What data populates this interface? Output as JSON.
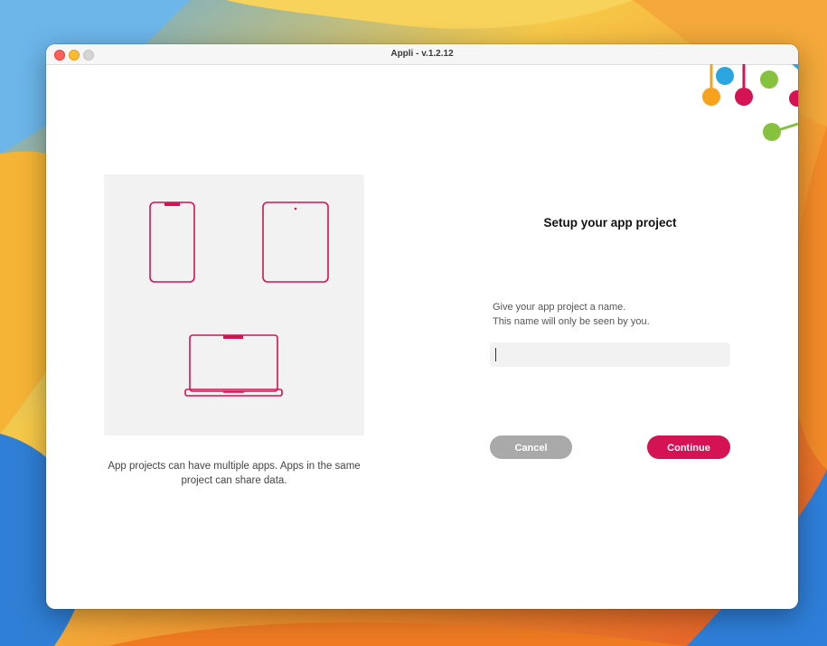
{
  "window": {
    "title": "Appli - v.1.2.12"
  },
  "illustration": {
    "icons": [
      "phone-icon",
      "tablet-icon",
      "laptop-icon"
    ],
    "caption": "App projects can have multiple apps. Apps in the same project can share data."
  },
  "form": {
    "heading": "Setup your app project",
    "instruction_line1": "Give your app project a name.",
    "instruction_line2": "This name will only be seen by you.",
    "name_value": "",
    "name_placeholder": ""
  },
  "buttons": {
    "cancel_label": "Cancel",
    "continue_label": "Continue"
  },
  "colors": {
    "accent": "#d51254",
    "cancel": "#a9a9a9",
    "logo_orange": "#f6a21f",
    "logo_blue": "#2aa6e0",
    "logo_green": "#86c23e",
    "logo_pink": "#d51254"
  }
}
